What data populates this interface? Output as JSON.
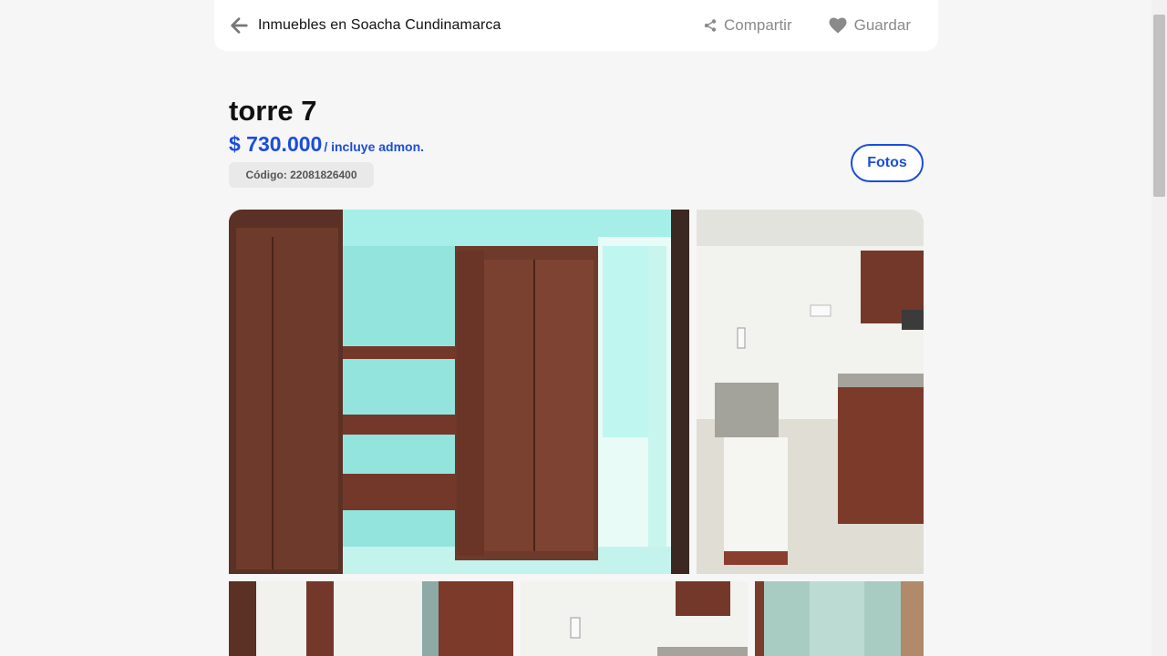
{
  "header": {
    "back_label": "Inmuebles en Soacha Cundinamarca",
    "share_label": "Compartir",
    "save_label": "Guardar"
  },
  "listing": {
    "title": "torre 7",
    "price": "$ 730.000",
    "price_note": "/ incluye admon.",
    "code": "Código: 22081826400",
    "photos_button": "Fotos"
  },
  "colors": {
    "accent": "#1b4ddb",
    "page_bg": "#f6f6f6",
    "muted": "#8a8a8a"
  },
  "icons": [
    "arrow-left-icon",
    "share-icon",
    "heart-icon"
  ]
}
